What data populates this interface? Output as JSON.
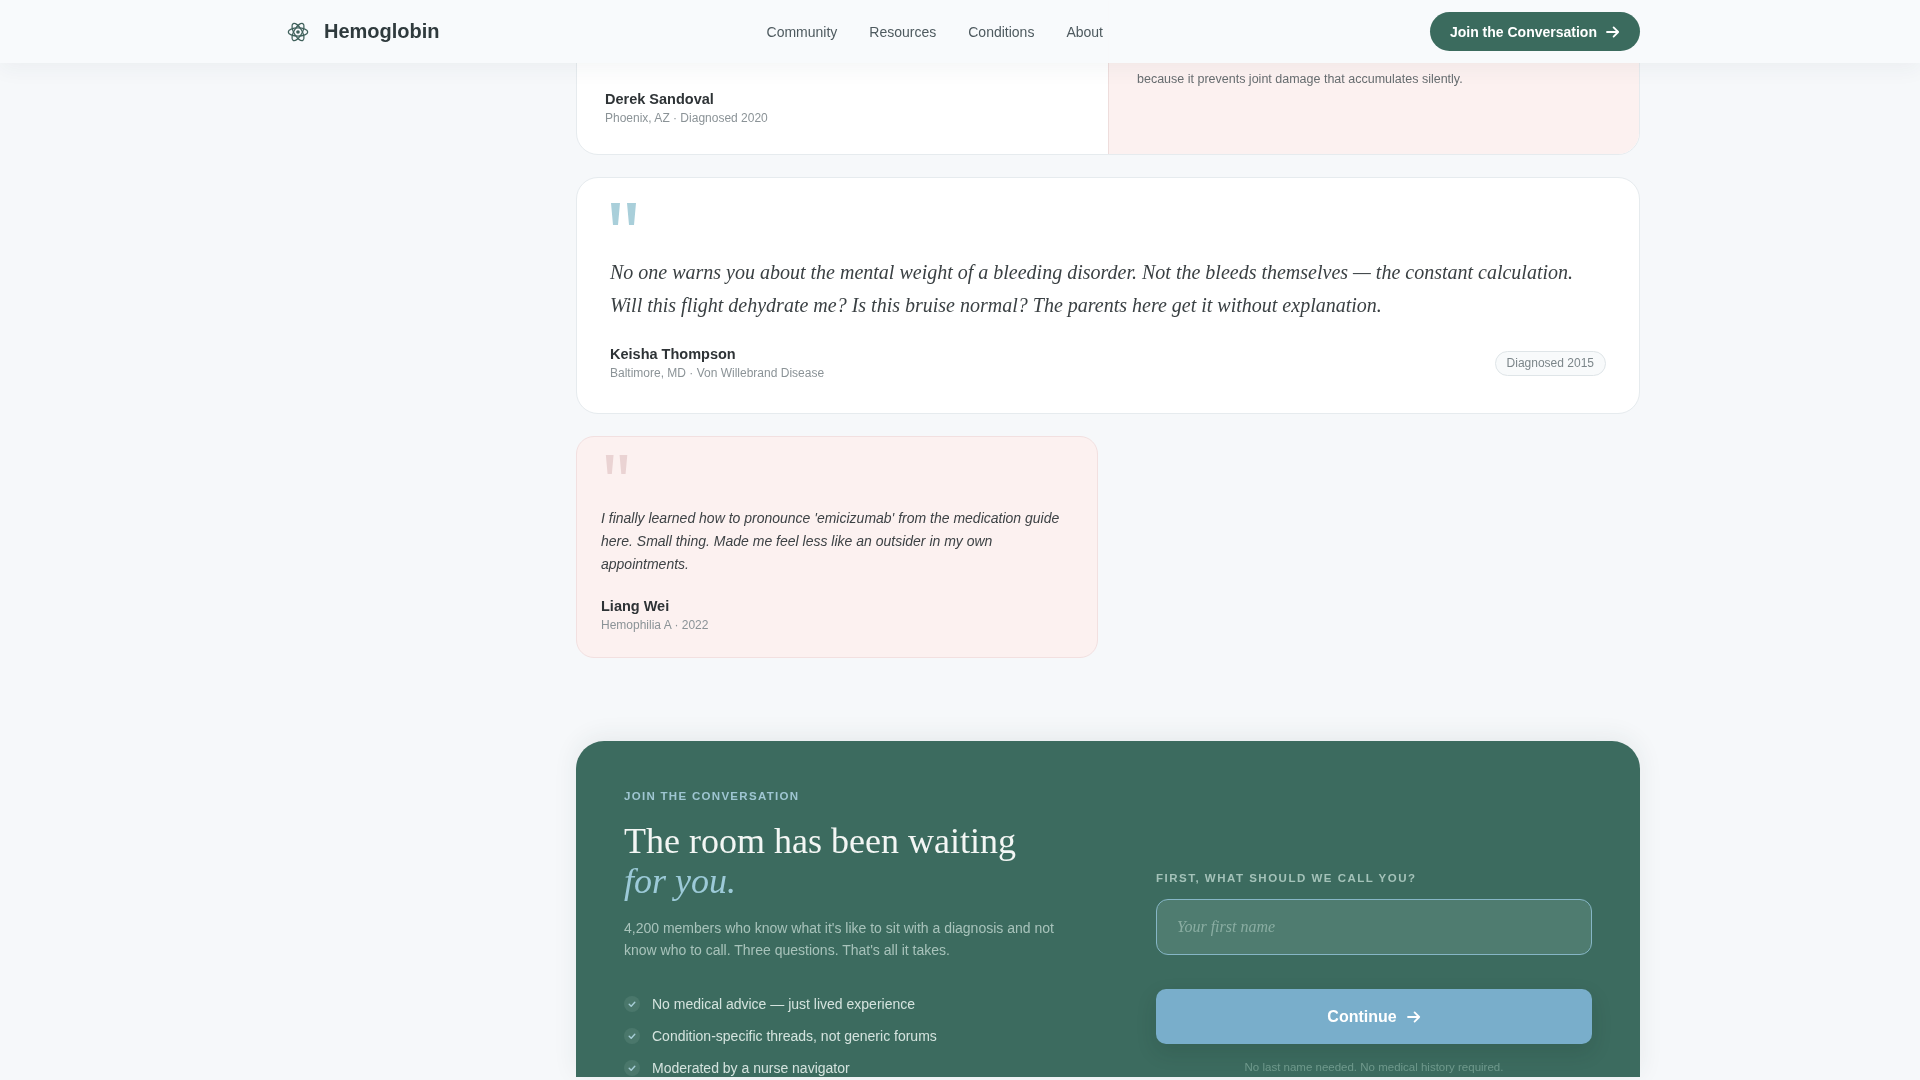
{
  "header": {
    "brand": "Hemoglobin",
    "nav": [
      {
        "label": "Community"
      },
      {
        "label": "Resources"
      },
      {
        "label": "Conditions"
      },
      {
        "label": "About"
      }
    ],
    "button": "Join the Conversation"
  },
  "testimonials": [
    {
      "kind": "split",
      "name": "Derek Sandoval",
      "details": "Phoenix, AZ · Diagnosed 2020",
      "aside": "because it prevents joint damage that accumulates silently."
    },
    {
      "kind": "featured",
      "quote": "No one warns you about the mental weight of a bleeding disorder. Not the bleeds themselves — the constant calculation. Will this flight dehydrate me? Is this bruise normal? The parents here get it without explanation.",
      "name": "Keisha Thompson",
      "details": "Baltimore, MD · Von Willebrand Disease",
      "badge": "Diagnosed 2015"
    },
    {
      "kind": "tinted",
      "quote": "I finally learned how to pronounce 'emicizumab' from the medication guide here. Small thing. Made me feel less like an outsider in my own appointments.",
      "name": "Liang Wei",
      "details": "Hemophilia A · 2022"
    }
  ],
  "join": {
    "eyebrow": "JOIN THE CONVERSATION",
    "heading": "The room has been waiting *for you.*",
    "text": "4,200 members who know what it's like to sit with a diagnosis and not know who to call. Three questions. That's all it takes.",
    "points": [
      "No medical advice — just lived experience",
      "Condition-specific threads, not generic forums",
      "Moderated by a nurse navigator"
    ],
    "form": {
      "label": "FIRST, WHAT SHOULD WE CALL YOU?",
      "placeholder": "Your first name",
      "button": "Continue",
      "note": "No last name needed. No medical history required."
    }
  }
}
